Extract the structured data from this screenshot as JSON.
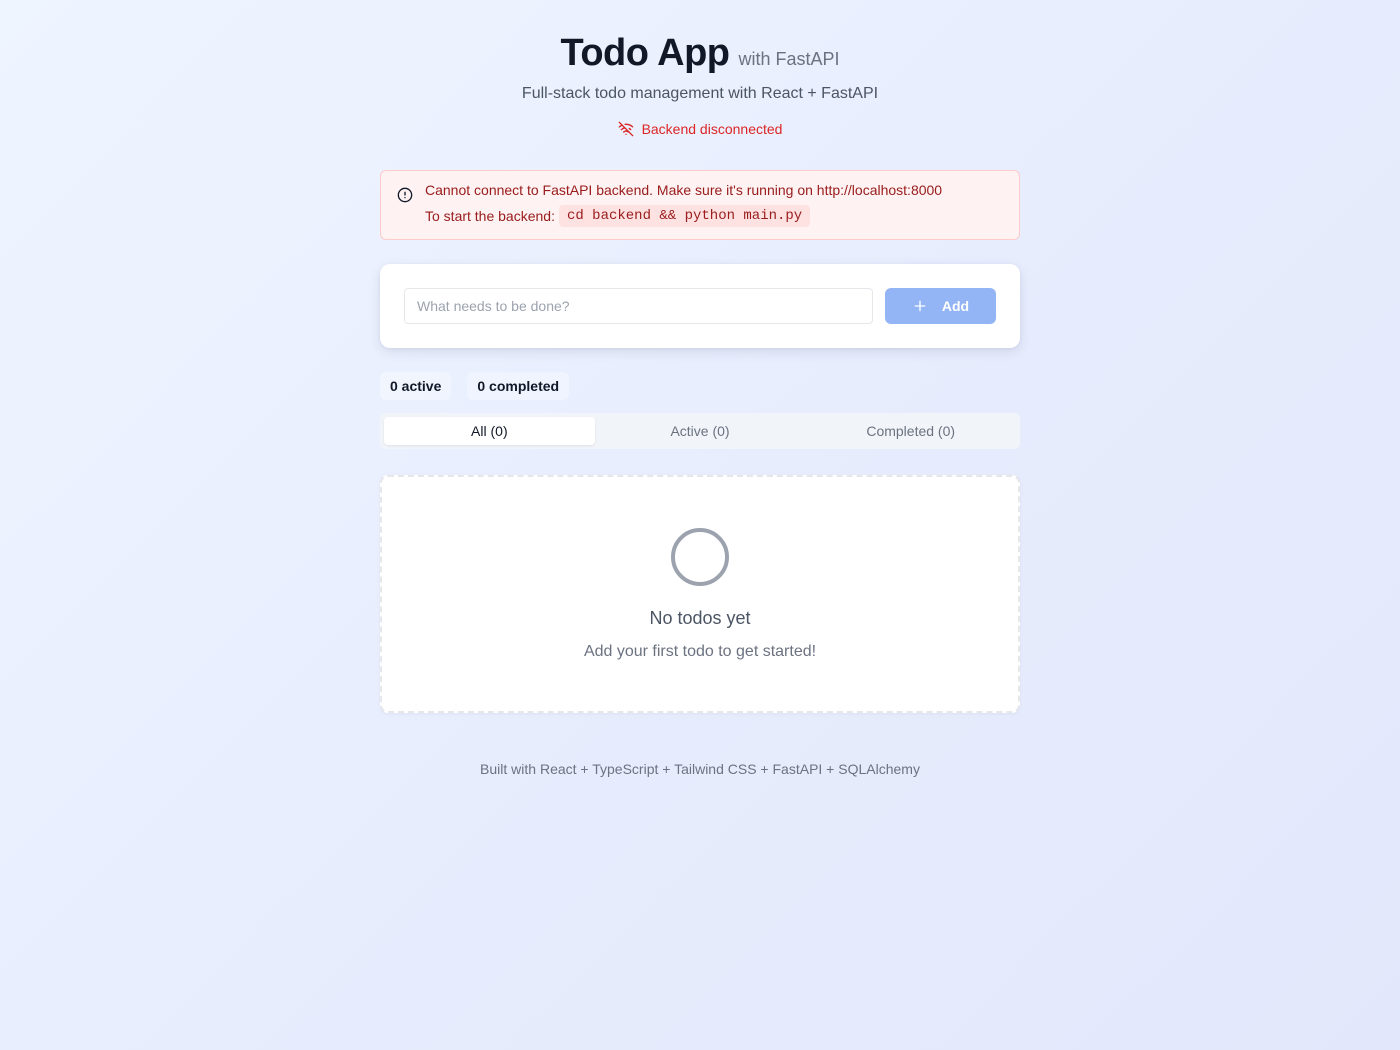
{
  "header": {
    "title": "Todo App",
    "title_suffix": "with FastAPI",
    "subtitle": "Full-stack todo management with React + FastAPI",
    "status_text": "Backend disconnected",
    "status_icon": "wifi-off-icon"
  },
  "alert": {
    "icon": "alert-circle-icon",
    "message": "Cannot connect to FastAPI backend. Make sure it's running on http://localhost:8000",
    "hint_label": "To start the backend:",
    "hint_command": "cd backend && python main.py"
  },
  "add_form": {
    "input_value": "",
    "input_placeholder": "What needs to be done?",
    "button_label": "Add",
    "button_icon": "plus-icon"
  },
  "counts": {
    "active": "0 active",
    "completed": "0 completed"
  },
  "tabs": [
    {
      "label": "All (0)",
      "selected": true
    },
    {
      "label": "Active (0)",
      "selected": false
    },
    {
      "label": "Completed (0)",
      "selected": false
    }
  ],
  "empty_state": {
    "icon": "circle-icon",
    "title": "No todos yet",
    "subtitle": "Add your first todo to get started!"
  },
  "footer": {
    "text": "Built with React + TypeScript + Tailwind CSS + FastAPI + SQLAlchemy"
  },
  "colors": {
    "error": "#dc2626",
    "add_button": "#93b4f5",
    "alert_bg": "#fef2f2"
  }
}
